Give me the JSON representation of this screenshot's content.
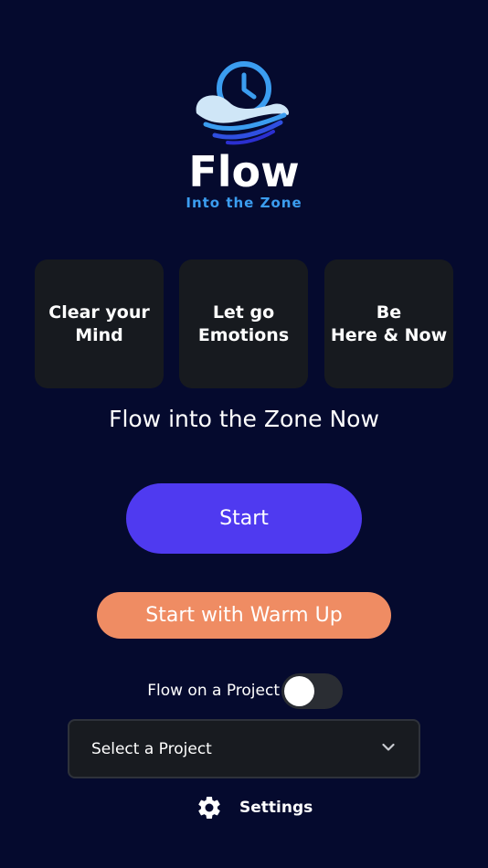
{
  "brand": {
    "title": "Flow",
    "subtitle": "Into the Zone"
  },
  "cards": [
    {
      "label": "Clear your\nMind"
    },
    {
      "label": "Let go\nEmotions"
    },
    {
      "label": "Be\nHere & Now"
    }
  ],
  "headline": "Flow into the Zone Now",
  "actions": {
    "start_label": "Start",
    "warmup_label": "Start with Warm Up"
  },
  "project": {
    "toggle_label": "Flow on a Project",
    "toggle_on": false,
    "select_value": "Select a Project"
  },
  "settings": {
    "label": "Settings"
  },
  "colors": {
    "background": "#050a2e",
    "card": "#171a1f",
    "start_button": "#4f3af0",
    "warmup_button": "#ef8c63",
    "brand_accent": "#3b9df0"
  },
  "icons": {
    "logo": "clock-wave-logo-icon",
    "select": "chevron-down-icon",
    "settings": "gear-icon"
  }
}
